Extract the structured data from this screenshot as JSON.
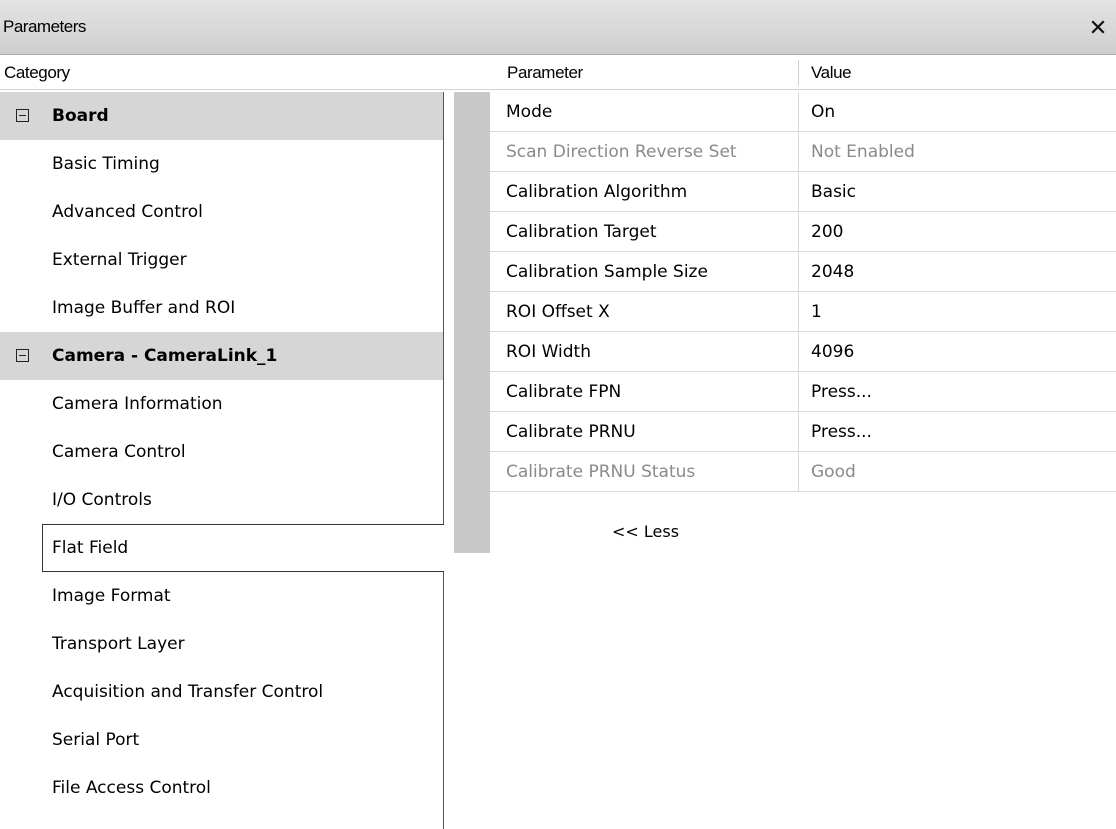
{
  "window": {
    "title": "Parameters"
  },
  "columns": {
    "category": "Category",
    "parameter": "Parameter",
    "value": "Value"
  },
  "categories": [
    {
      "label": "Board",
      "type": "group"
    },
    {
      "label": "Basic Timing",
      "type": "item"
    },
    {
      "label": "Advanced Control",
      "type": "item"
    },
    {
      "label": "External Trigger",
      "type": "item"
    },
    {
      "label": "Image Buffer and ROI",
      "type": "item"
    },
    {
      "label": "Camera - CameraLink_1",
      "type": "group"
    },
    {
      "label": "Camera Information",
      "type": "item"
    },
    {
      "label": "Camera Control",
      "type": "item"
    },
    {
      "label": "I/O Controls",
      "type": "item"
    },
    {
      "label": "Flat Field",
      "type": "item",
      "selected": true
    },
    {
      "label": "Image Format",
      "type": "item"
    },
    {
      "label": "Transport Layer",
      "type": "item"
    },
    {
      "label": "Acquisition and Transfer Control",
      "type": "item"
    },
    {
      "label": "Serial Port",
      "type": "item"
    },
    {
      "label": "File Access Control",
      "type": "item"
    }
  ],
  "parameters": [
    {
      "name": "Mode",
      "value": "On",
      "enabled": true
    },
    {
      "name": "Scan Direction Reverse Set",
      "value": "Not Enabled",
      "enabled": false
    },
    {
      "name": "Calibration Algorithm",
      "value": "Basic",
      "enabled": true
    },
    {
      "name": "Calibration Target",
      "value": "200",
      "enabled": true
    },
    {
      "name": "Calibration Sample Size",
      "value": "2048",
      "enabled": true
    },
    {
      "name": "ROI Offset X",
      "value": "1",
      "enabled": true
    },
    {
      "name": "ROI Width",
      "value": "4096",
      "enabled": true
    },
    {
      "name": "Calibrate FPN",
      "value": "Press...",
      "enabled": true
    },
    {
      "name": "Calibrate PRNU",
      "value": "Press...",
      "enabled": true
    },
    {
      "name": "Calibrate PRNU Status",
      "value": "Good",
      "enabled": false
    }
  ],
  "less_label": "<< Less",
  "icons": {
    "close": "close-icon",
    "collapse": "collapse-minus-icon"
  },
  "colors": {
    "group_bg": "#d6d6d6",
    "disabled_text": "#8a8a8a",
    "strip": "#c8c8c8"
  }
}
